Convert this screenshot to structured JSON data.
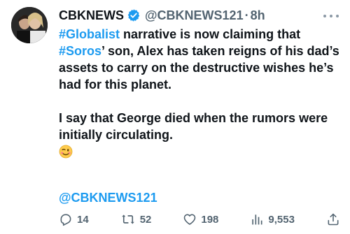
{
  "tweet": {
    "author_name": "CBKNEWS",
    "handle": "@CBKNEWS121",
    "separator": "·",
    "time": "8h",
    "body": {
      "hashtag1": "#Globalist",
      "line1_rest": " narrative is now claiming that",
      "hashtag2": "#Soros",
      "line2_rest": "’ son, Alex has taken reigns of his dad’s assets to carry on the destructive wishes he’s had for this planet.",
      "paragraph2": "I say that George died when the rumors were initially circulating.",
      "emoji": "😉"
    },
    "signoff": "@CBKNEWS121"
  },
  "actions": {
    "replies": "14",
    "retweets": "52",
    "likes": "198",
    "views": "9,553"
  },
  "icons": {
    "verified": "verified-badge-icon",
    "more": "more-icon",
    "reply": "reply-icon",
    "retweet": "retweet-icon",
    "like": "heart-icon",
    "views": "views-icon",
    "share": "share-icon"
  },
  "colors": {
    "accent": "#1d9bf0",
    "text": "#0f1419",
    "muted": "#536471"
  }
}
